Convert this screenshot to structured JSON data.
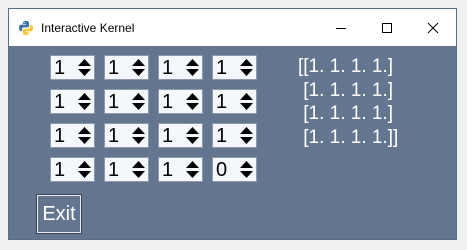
{
  "window": {
    "title": "Interactive Kernel"
  },
  "spinboxes": [
    [
      "1",
      "1",
      "1",
      "1"
    ],
    [
      "1",
      "1",
      "1",
      "1"
    ],
    [
      "1",
      "1",
      "1",
      "1"
    ],
    [
      "1",
      "1",
      "1",
      "0"
    ]
  ],
  "matrix_output": [
    "[[1. 1. 1. 1.]",
    " [1. 1. 1. 1.]",
    " [1. 1. 1. 1.]",
    " [1. 1. 1. 1.]]"
  ],
  "exit_button": {
    "label": "Exit"
  },
  "icons": {
    "app": "python-icon",
    "minimize": "minimize-icon",
    "maximize": "maximize-icon",
    "close": "close-icon",
    "spin": "spin-arrows-icon"
  },
  "colors": {
    "client_background": "#63758f",
    "titlebar_background": "#ffffff",
    "spinbox_background": "#f4f7fb",
    "text_light": "#ffffff"
  }
}
